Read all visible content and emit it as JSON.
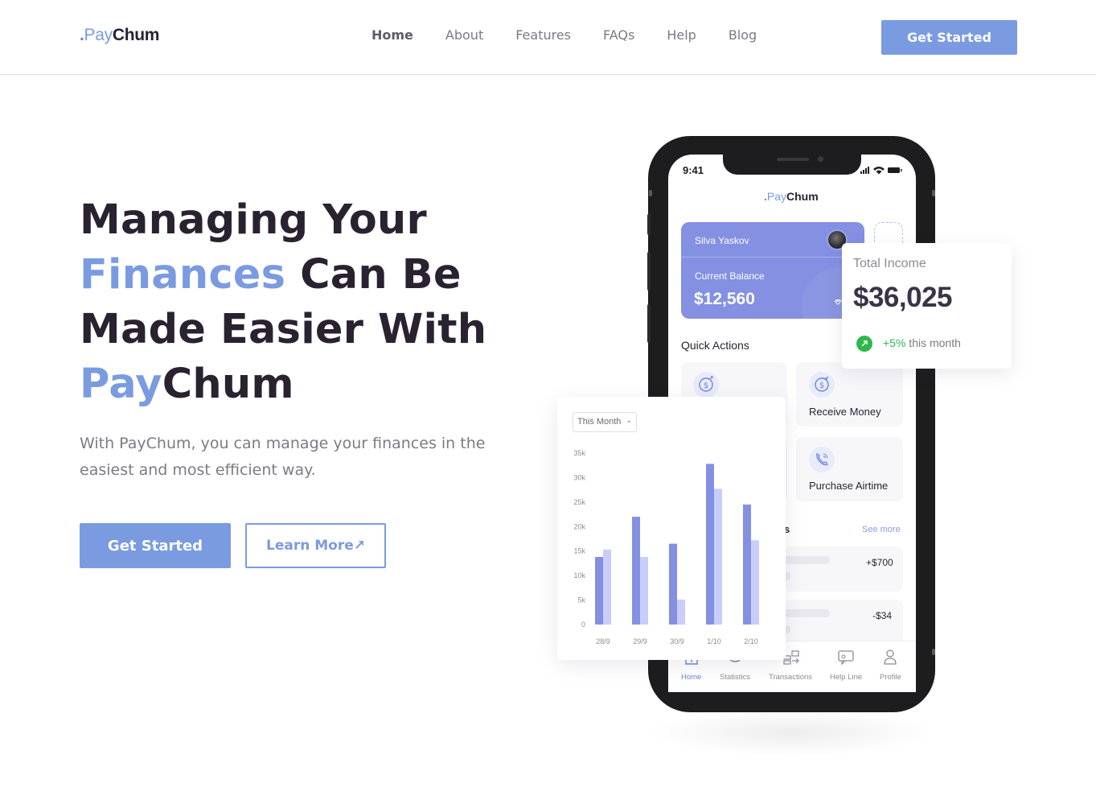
{
  "header": {
    "logo": {
      "dot": ".",
      "pay": "Pay",
      "chum": "Chum"
    },
    "nav": [
      {
        "label": "Home",
        "active": true
      },
      {
        "label": "About",
        "active": false
      },
      {
        "label": "Features",
        "active": false
      },
      {
        "label": "FAQs",
        "active": false
      },
      {
        "label": "Help",
        "active": false
      },
      {
        "label": "Blog",
        "active": false
      }
    ],
    "cta_label": "Get Started"
  },
  "hero": {
    "headline": {
      "l1": "Managing Your",
      "l2_accent": "Finances",
      "l2_rest": " Can Be",
      "l3": "Made Easier With",
      "l4_accent": "Pay",
      "l4_rest": "Chum"
    },
    "subtitle": "With PayChum, you can manage your finances in the easiest and most efficient way.",
    "primary_button": "Get Started",
    "secondary_button": "Learn More↗"
  },
  "phone": {
    "time": "9:41",
    "app_logo": {
      "dot": ".",
      "pay": "Pay",
      "chum": "Chum"
    },
    "card": {
      "name": "Silva Yaskov",
      "balance_label": "Current Balance",
      "balance": "$12,560"
    },
    "quick_actions_title": "Quick Actions",
    "quick_actions": [
      {
        "label": "",
        "icon": "send-money-icon"
      },
      {
        "label": "Receive Money",
        "icon": "receive-money-icon"
      },
      {
        "label": "",
        "icon": "placeholder"
      },
      {
        "label": "Purchase Airtime",
        "icon": "phone-icon"
      }
    ],
    "transactions_title_fragment": "s",
    "see_more": "See more",
    "transactions": [
      {
        "amount": "+$700"
      },
      {
        "amount": "-$34"
      }
    ],
    "tabs": [
      {
        "label": "Home",
        "icon": "home-icon",
        "active": true
      },
      {
        "label": "Statistics",
        "icon": "statistics-icon",
        "active": false
      },
      {
        "label": "Transactions",
        "icon": "transactions-icon",
        "active": false
      },
      {
        "label": "Help Line",
        "icon": "chat-icon",
        "active": false
      },
      {
        "label": "Profile",
        "icon": "profile-icon",
        "active": false
      }
    ]
  },
  "income_card": {
    "label": "Total Income",
    "value": "$36,025",
    "change": "+5%",
    "period": " this month"
  },
  "chart_card": {
    "dropdown": "This Month"
  },
  "colors": {
    "accent": "#7a9be0",
    "dark": "#2a2230",
    "card": "#8490e2",
    "bar_primary": "#8490e2",
    "bar_secondary": "#c9cdfa",
    "positive": "#2db84d"
  },
  "chart_data": {
    "type": "bar",
    "categories": [
      "28/9",
      "29/9",
      "30/9",
      "1/10",
      "2/10"
    ],
    "series": [
      {
        "values": [
          13800,
          22000,
          16500,
          32800,
          24500
        ]
      },
      {
        "values": [
          15300,
          13800,
          5100,
          27700,
          17200
        ]
      }
    ],
    "yticks": [
      "0",
      "5k",
      "10k",
      "15k",
      "20k",
      "25k",
      "30k",
      "35k"
    ],
    "ylim": [
      0,
      35000
    ],
    "legend": "none",
    "grid": false
  }
}
